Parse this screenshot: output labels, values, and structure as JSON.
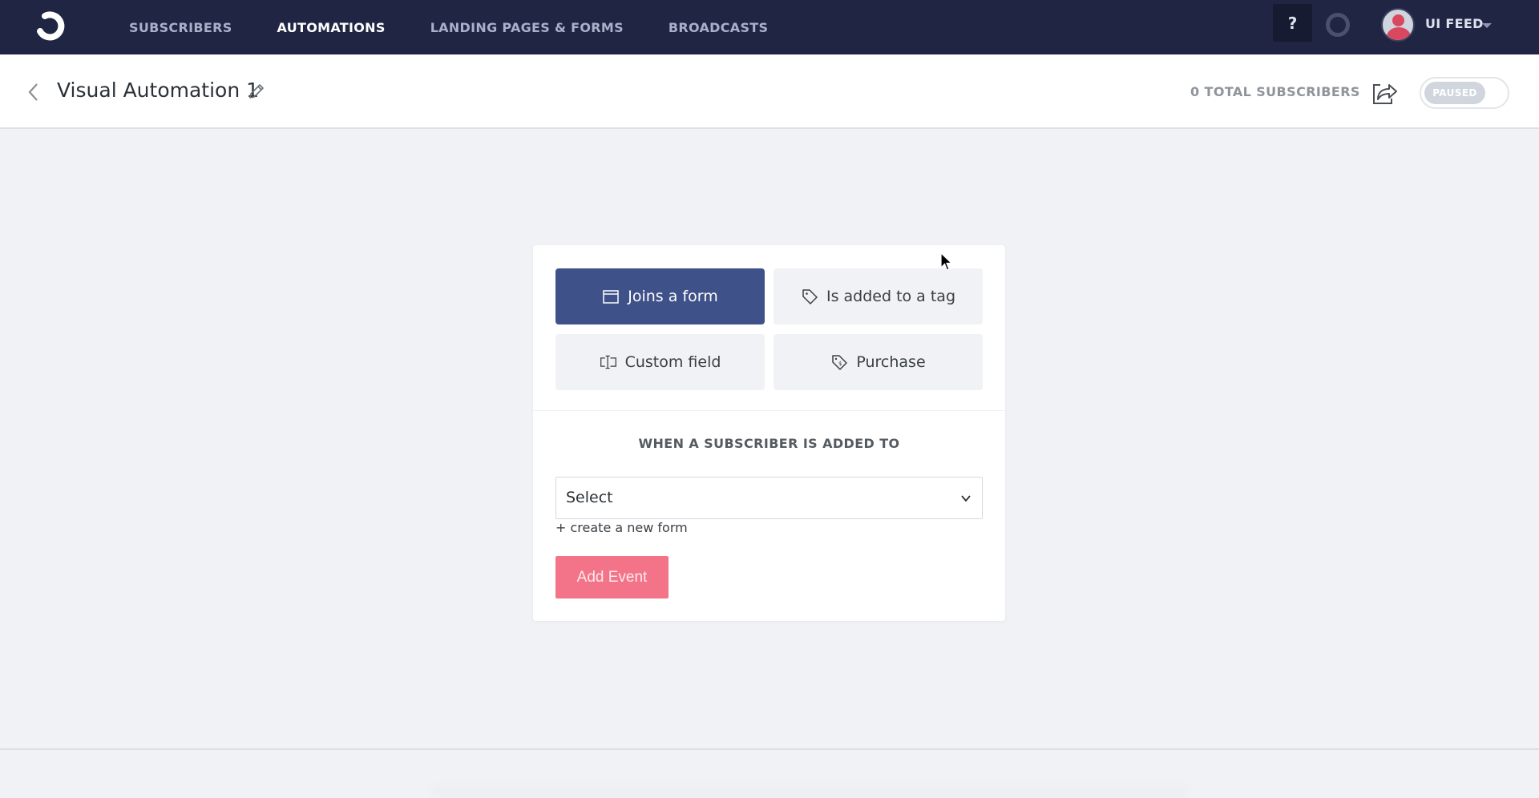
{
  "topnav": {
    "logo": "convertkit-logo",
    "items": [
      {
        "label": "SUBSCRIBERS",
        "active": false
      },
      {
        "label": "AUTOMATIONS",
        "active": true
      },
      {
        "label": "LANDING PAGES & FORMS",
        "active": false
      },
      {
        "label": "BROADCASTS",
        "active": false
      }
    ],
    "help_label": "?",
    "user": {
      "name": "UI FEED",
      "avatar_icon": "user-avatar-icon"
    }
  },
  "subheader": {
    "title": "Visual Automation 1",
    "total_subscribers": "0 TOTAL SUBSCRIBERS",
    "status_toggle": {
      "label": "PAUSED",
      "on": false
    }
  },
  "card": {
    "triggers": [
      {
        "label": "Joins a form",
        "icon": "form-icon",
        "active": true
      },
      {
        "label": "Is added to a tag",
        "icon": "tag-icon",
        "active": false
      },
      {
        "label": "Custom field",
        "icon": "custom-field-icon",
        "active": false
      },
      {
        "label": "Purchase",
        "icon": "purchase-tag-icon",
        "active": false
      }
    ],
    "when_label": "WHEN A SUBSCRIBER IS ADDED TO",
    "select": {
      "value": "Select"
    },
    "create_link": "+ create a new form",
    "add_event_label": "Add Event"
  },
  "colors": {
    "nav_bg": "#1f2543",
    "active_trigger": "#3f5189",
    "add_event": "#f37489",
    "page_bg": "#f1f2f6"
  }
}
